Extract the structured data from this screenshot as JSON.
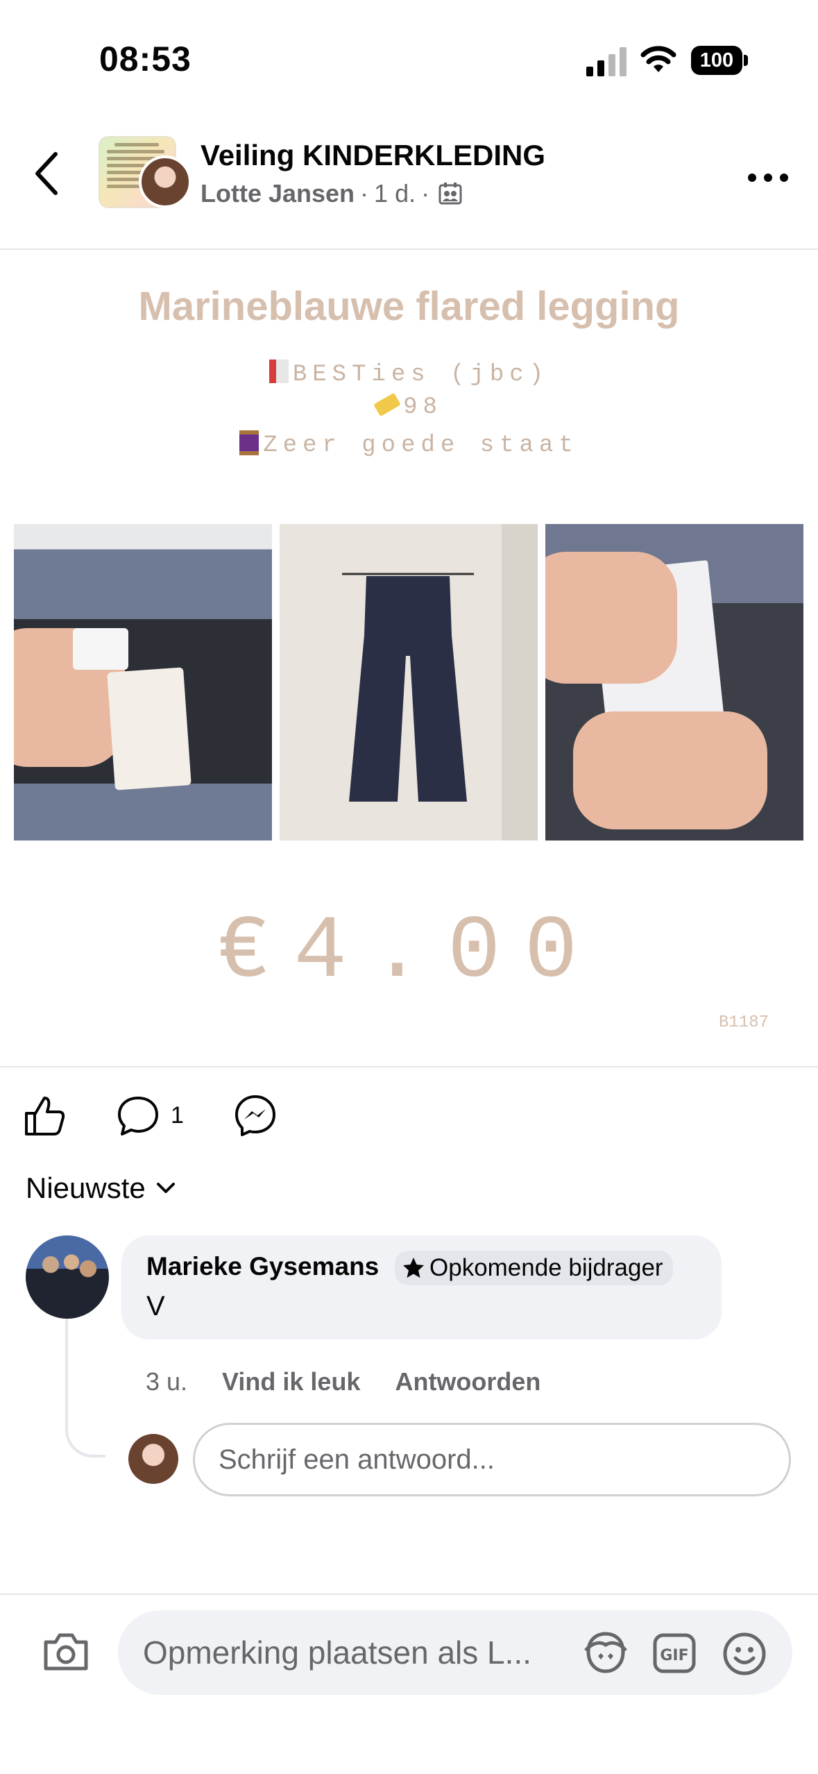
{
  "status": {
    "time": "08:53",
    "battery": "100"
  },
  "header": {
    "group_name": "Veiling KINDERKLEDING",
    "author": "Lotte Jansen",
    "time_ago": "1 d.",
    "separator": "·"
  },
  "post": {
    "title": "Marineblauwe flared legging",
    "brand": "BESTies (jbc)",
    "size": "98",
    "condition": "Zeer goede staat",
    "price": "€4.00",
    "code": "B1187"
  },
  "actions": {
    "comment_count": "1"
  },
  "comments": {
    "sort_label": "Nieuwste",
    "items": [
      {
        "name": "Marieke Gysemans",
        "badge": "Opkomende bijdrager",
        "text": "V",
        "time": "3 u.",
        "like_label": "Vind ik leuk",
        "reply_label": "Antwoorden"
      }
    ],
    "reply_placeholder": "Schrijf een antwoord..."
  },
  "composer": {
    "placeholder": "Opmerking plaatsen als L..."
  }
}
